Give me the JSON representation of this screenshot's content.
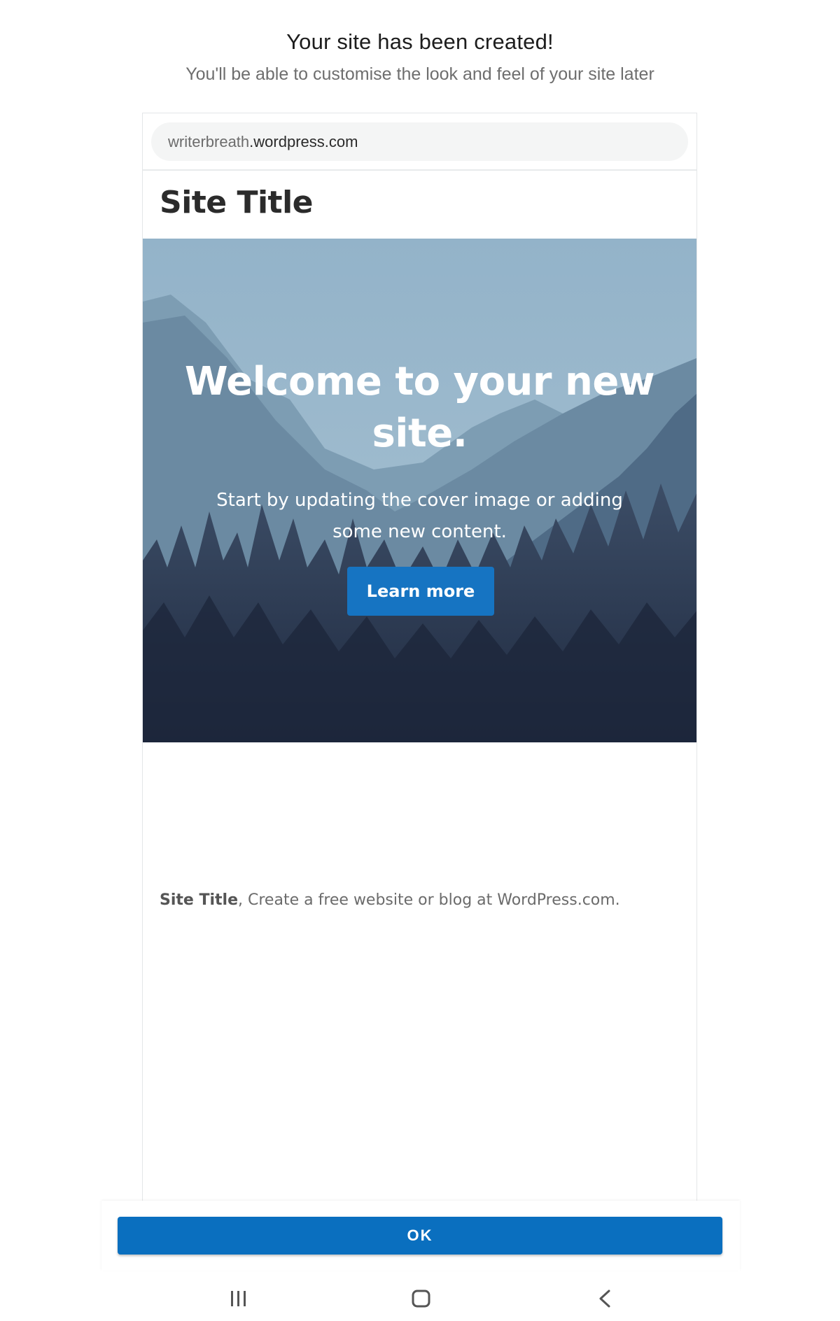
{
  "header": {
    "title": "Your site has been created!",
    "subtitle": "You'll be able to customise the look and feel of your site later"
  },
  "preview": {
    "url": {
      "subdomain": "writerbreath",
      "domain": ".wordpress.com"
    },
    "site_title": "Site Title",
    "cover": {
      "heading": "Welcome to your new site.",
      "text": "Start by updating the cover image or adding some new content.",
      "button_label": "Learn more"
    },
    "footer": {
      "site_name": "Site Title",
      "text": ", Create a free website or blog at WordPress.com."
    }
  },
  "actions": {
    "ok_label": "OK"
  },
  "navbar": {
    "icons": [
      "recent-apps-icon",
      "home-icon",
      "back-icon"
    ]
  },
  "colors": {
    "accent": "#0a6fbf",
    "cover_button": "#1674c2",
    "sky": "#8fb0c6",
    "forest": "#243049"
  }
}
